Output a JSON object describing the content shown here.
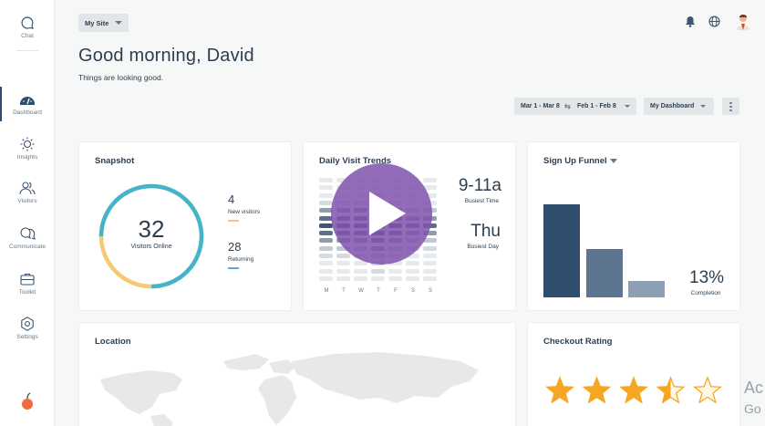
{
  "sidebar": {
    "items": [
      {
        "label": "Chat",
        "icon": "chat-icon"
      },
      {
        "label": "Dashboard",
        "icon": "dashboard-icon",
        "active": true
      },
      {
        "label": "Insights",
        "icon": "insights-icon"
      },
      {
        "label": "Visitors",
        "icon": "visitors-icon"
      },
      {
        "label": "Communicate",
        "icon": "communicate-icon"
      },
      {
        "label": "Toolkit",
        "icon": "toolkit-icon"
      },
      {
        "label": "Settings",
        "icon": "settings-icon"
      }
    ]
  },
  "header": {
    "site_select": "My Site",
    "greeting": "Good morning, David",
    "subtitle": "Things are looking good.",
    "range_a": "Mar 1 - Mar 8",
    "range_b": "Feb 1 - Feb 8",
    "dashboard_select": "My Dashboard"
  },
  "snapshot": {
    "title": "Snapshot",
    "visitors_online": "32",
    "visitors_online_label": "Visitors Online",
    "new_visitors": "4",
    "new_visitors_label": "New visitors",
    "returning": "28",
    "returning_label": "Returning",
    "colors": {
      "new": "#f6c96f",
      "returning": "#43b4cc"
    }
  },
  "trends": {
    "title": "Daily Visit Trends",
    "busiest_time": "9-11a",
    "busiest_time_label": "Busiest Time",
    "busiest_day": "Thu",
    "busiest_day_label": "Busiest Day",
    "days": [
      "M",
      "T",
      "W",
      "T",
      "F",
      "S",
      "S"
    ]
  },
  "funnel": {
    "title": "Sign Up Funnel",
    "completion": "13%",
    "completion_label": "Completion",
    "colors": [
      "#2f4d6d",
      "#5d7590",
      "#8d9fb2"
    ]
  },
  "location": {
    "title": "Location"
  },
  "checkout": {
    "title": "Checkout Rating",
    "rating_stars": 3.5,
    "max_stars": 5,
    "star_color": "#f5a623"
  },
  "overlay": {
    "activate_line1": "Ac",
    "activate_line2": "Go"
  }
}
